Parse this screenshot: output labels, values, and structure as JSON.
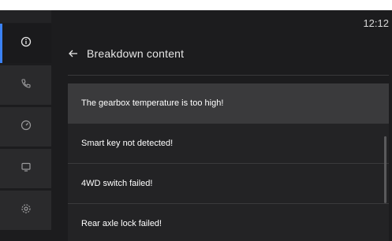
{
  "status_bar": {
    "time": "12:12"
  },
  "sidebar": {
    "items": [
      {
        "icon": "info-icon",
        "active": true
      },
      {
        "icon": "phone-icon",
        "active": false
      },
      {
        "icon": "gauge-icon",
        "active": false
      },
      {
        "icon": "display-icon",
        "active": false
      },
      {
        "icon": "gear-icon",
        "active": false
      }
    ]
  },
  "header": {
    "title": "Breakdown content"
  },
  "faults": [
    {
      "label": "The gearbox temperature is too high!"
    },
    {
      "label": "Smart key not detected!"
    },
    {
      "label": "4WD switch failed!"
    },
    {
      "label": "Rear axle lock failed!"
    }
  ],
  "colors": {
    "background": "#1c1c1e",
    "accent": "#3b82f6",
    "row_highlight": "#3a3a3c",
    "text": "#ffffff"
  }
}
